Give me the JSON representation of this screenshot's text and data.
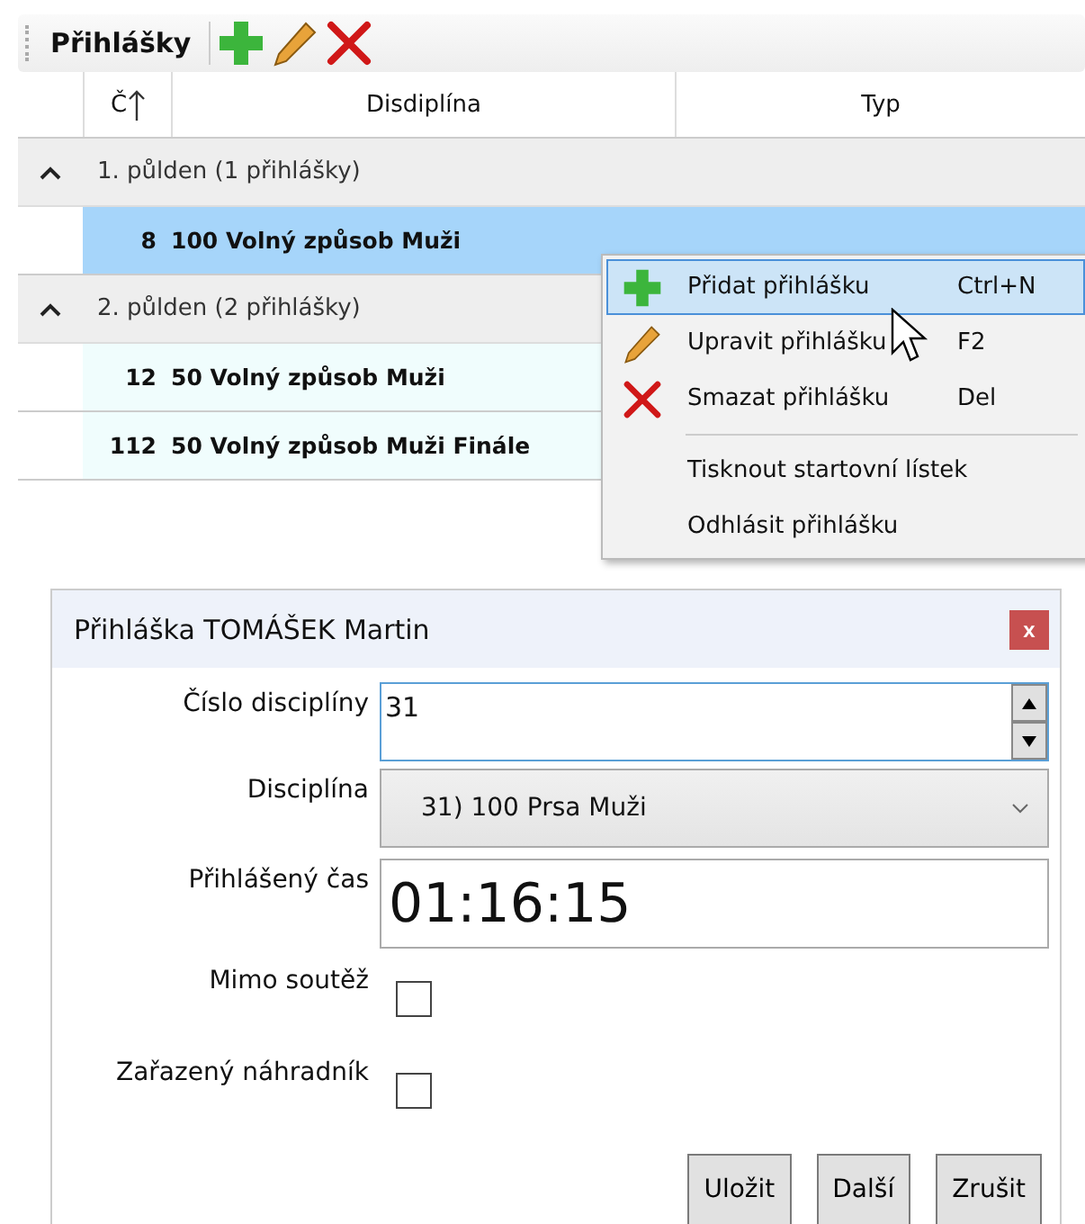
{
  "toolbar": {
    "title": "Přihlášky"
  },
  "table": {
    "columns": [
      "Č",
      "Disdiplína",
      "Typ"
    ],
    "groups": [
      {
        "label": "1. půlden (1 přihlášky)",
        "expanded": true,
        "rows": [
          {
            "number": "8",
            "discipline": "100 Volný způsob Muži",
            "selected": true
          }
        ]
      },
      {
        "label": "2. půlden (2 přihlášky)",
        "expanded": true,
        "rows": [
          {
            "number": "12",
            "discipline": "50 Volný způsob Muži",
            "selected": false
          },
          {
            "number": "112",
            "discipline": "50 Volný způsob Muži Finále",
            "selected": false
          }
        ]
      }
    ]
  },
  "context_menu": {
    "items": [
      {
        "kind": "add",
        "label": "Přidat přihlášku",
        "shortcut": "Ctrl+N",
        "selected": true
      },
      {
        "kind": "edit",
        "label": "Upravit přihlášku",
        "shortcut": "F2",
        "selected": false
      },
      {
        "kind": "delete",
        "label": "Smazat přihlášku",
        "shortcut": "Del",
        "selected": false
      },
      {
        "kind": "separator"
      },
      {
        "kind": "plain",
        "label": "Tisknout startovní lístek",
        "selected": false
      },
      {
        "kind": "plain",
        "label": "Odhlásit přihlášku",
        "selected": false
      }
    ]
  },
  "dialog": {
    "title": "Přihláška TOMÁŠEK Martin",
    "close": "x",
    "fields": [
      {
        "kind": "spin",
        "label": "Číslo disciplíny",
        "value": "31"
      },
      {
        "kind": "combo",
        "label": "Disciplína",
        "value": "31) 100 Prsa Muži"
      },
      {
        "kind": "big",
        "label": "Přihlášený čas",
        "value": "01:16:15"
      },
      {
        "kind": "check",
        "label": "Mimo soutěž",
        "checked": false
      },
      {
        "kind": "check",
        "label": "Zařazený náhradník",
        "checked": false
      }
    ],
    "buttons": [
      "Uložit",
      "Další",
      "Zrušit"
    ]
  }
}
